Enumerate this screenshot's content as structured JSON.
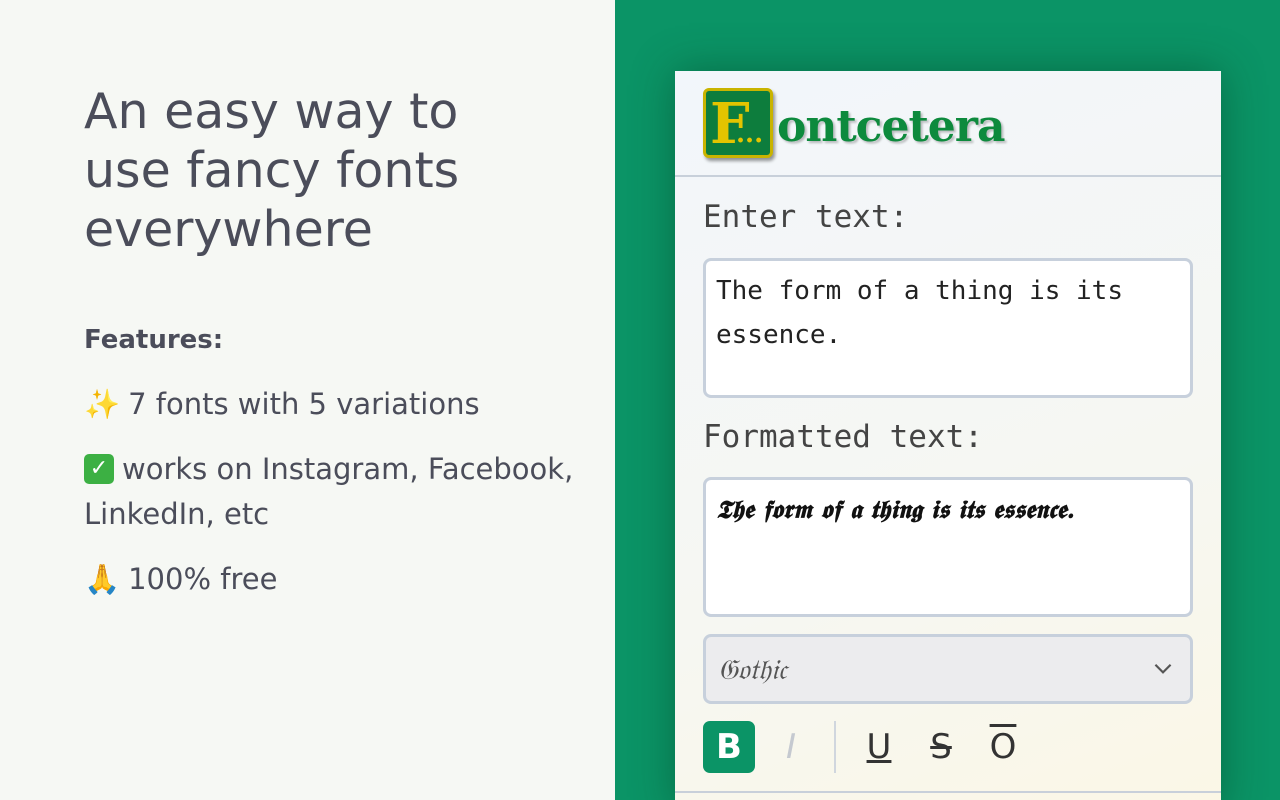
{
  "promo": {
    "headline": "An easy way to use fancy fonts everywhere",
    "features_title": "Features:",
    "features": [
      {
        "icon": "sparkles-icon",
        "glyph": "✨",
        "text": "7 fonts with 5 variations"
      },
      {
        "icon": "check-mark-button-icon",
        "glyph": "✓",
        "text": "works on Instagram, Facebook, LinkedIn, etc"
      },
      {
        "icon": "folded-hands-icon",
        "glyph": "🙏",
        "text": "100% free"
      }
    ]
  },
  "app": {
    "logo_letter": "F",
    "logo_dots": "...",
    "logo_text": "ontcetera",
    "enter_label": "Enter text:",
    "input_value": "The form of a thing is its essence.",
    "formatted_label": "Formatted text:",
    "output_value": "𝕿𝖍𝖊 𝖋𝖔𝖗𝖒 𝖔𝖋 𝖆 𝖙𝖍𝖎𝖓𝖌 𝖎𝖘 𝖎𝖙𝖘 𝖊𝖘𝖘𝖊𝖓𝖈𝖊.",
    "font_select": "𝔊𝔬𝔱𝔥𝔦𝔠",
    "toolbar": {
      "bold": "B",
      "italic": "I",
      "underline": "U",
      "strikethrough": "S",
      "overline": "O"
    }
  },
  "colors": {
    "brand_green": "#0b9466",
    "logo_gold": "#e3c400",
    "text_gray": "#4b4d5a"
  }
}
